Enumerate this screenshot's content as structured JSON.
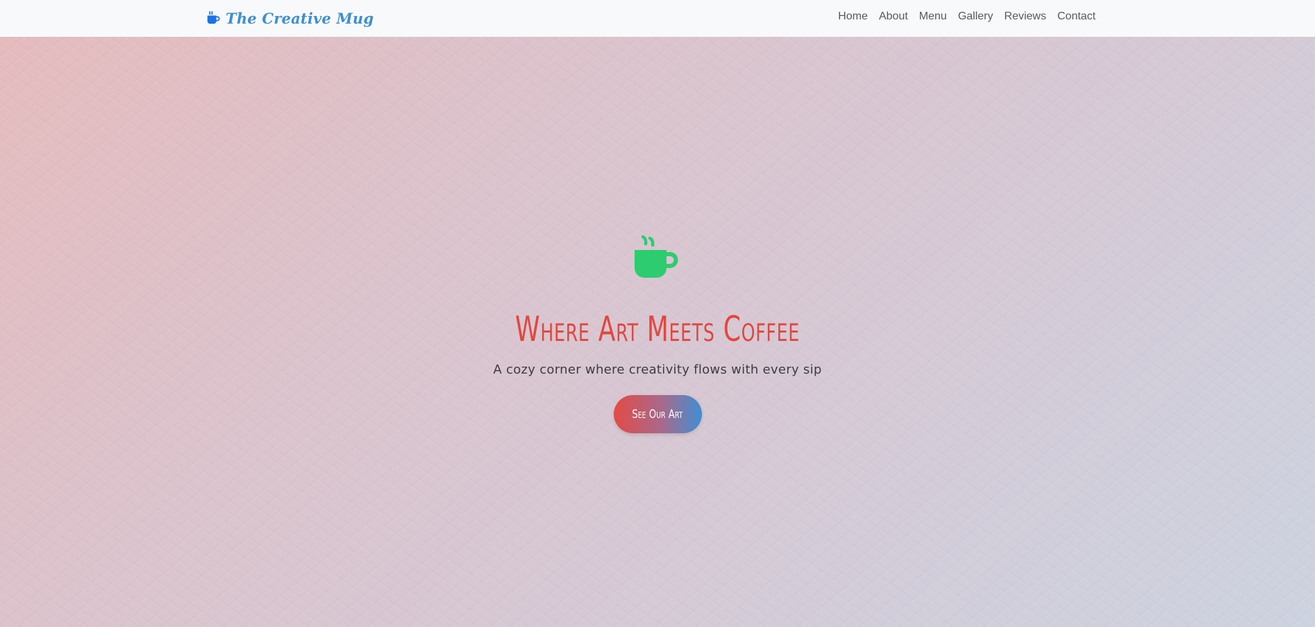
{
  "navbar": {
    "brand": {
      "icon": "coffee-mug-icon",
      "text": "The Creative Mug"
    },
    "links": [
      {
        "label": "Home"
      },
      {
        "label": "About"
      },
      {
        "label": "Menu"
      },
      {
        "label": "Gallery"
      },
      {
        "label": "Reviews"
      },
      {
        "label": "Contact"
      }
    ]
  },
  "hero": {
    "icon": "coffee-mug-icon",
    "title": "Where Art Meets Coffee",
    "subtitle": "A cozy corner where creativity flows with every sip",
    "cta_label": "See Our Art"
  },
  "colors": {
    "brand_blue": "#3d8fd0",
    "icon_green": "#2ecc71",
    "title_red": "#e0473f",
    "nav_bg": "#f8f9fa"
  }
}
